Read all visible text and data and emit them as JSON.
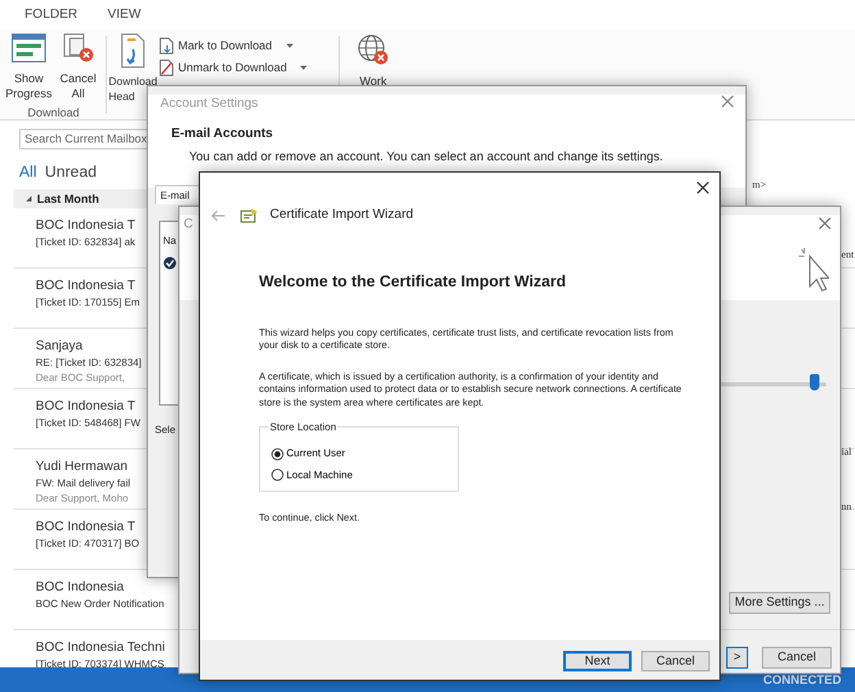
{
  "ribbon": {
    "tabs": [
      {
        "label": "FOLDER"
      },
      {
        "label": "VIEW"
      }
    ],
    "show_progress_button": {
      "label": "Show Progress"
    },
    "cancel_all_button": {
      "label": "Cancel All"
    },
    "group_label": "Download",
    "download_headers_button": {
      "label": "Download Head"
    },
    "small_buttons": [
      {
        "label": "Mark to Download"
      },
      {
        "label": "Unmark to Download"
      }
    ],
    "work_button": {
      "label": "Work"
    }
  },
  "mailbox": {
    "search": {
      "placeholder": "Search Current Mailbox"
    },
    "filters": [
      {
        "label": "All",
        "selected": true
      },
      {
        "label": "Unread",
        "selected": false
      }
    ],
    "group_header": "Last Month",
    "messages": [
      {
        "sender": "BOC Indonesia T",
        "lines": [
          "[Ticket ID: 632834] ak"
        ]
      },
      {
        "sender": "BOC Indonesia T",
        "lines": [
          "[Ticket ID: 170155] Em"
        ]
      },
      {
        "sender": "Sanjaya",
        "lines": [
          "RE: [Ticket ID: 632834]",
          "Dear BOC Support,"
        ]
      },
      {
        "sender": "BOC Indonesia T",
        "lines": [
          "[Ticket ID: 548468] FW"
        ]
      },
      {
        "sender": "Yudi Hermawan",
        "lines": [
          "FW: Mail delivery fail",
          "Dear Support,  Moho"
        ]
      },
      {
        "sender": "BOC Indonesia T",
        "lines": [
          "[Ticket ID: 470317] BO"
        ]
      },
      {
        "sender": "BOC Indonesia",
        "lines": [
          "BOC New Order Notification"
        ]
      },
      {
        "sender": "BOC Indonesia Techni",
        "lines": [
          "[Ticket ID: 703374] WHMCS"
        ]
      }
    ]
  },
  "reading_pane": [
    "m>",
    "ent",
    "ial",
    "nn"
  ],
  "status_bar": {
    "text": "CONNECTED"
  },
  "account_settings": {
    "title": "Account Settings",
    "heading": "E-mail Accounts",
    "description": "You can add or remove an account. You can select an account and change its settings.",
    "tab": "E-mail",
    "column_header": "Na",
    "footer_text": "Sele"
  },
  "change_account": {
    "title": "C",
    "slider": {
      "level": 0.98
    },
    "more_settings_button": "More Settings ...",
    "next_button": ">",
    "cancel_button": "Cancel"
  },
  "wizard": {
    "title": "Certificate Import Wizard",
    "heading": "Welcome to the Certificate Import Wizard",
    "paragraphs": [
      "This wizard helps you copy certificates, certificate trust lists, and certificate revocation lists from your disk to a certificate store.",
      "A certificate, which is issued by a certification authority, is a confirmation of your identity and contains information used to protect data or to establish secure network connections. A certificate store is the system area where certificates are kept."
    ],
    "store_location": {
      "legend": "Store Location",
      "options": [
        {
          "label": "Current User",
          "selected": true
        },
        {
          "label": "Local Machine",
          "selected": false
        }
      ]
    },
    "hint": "To continue, click Next.",
    "buttons": [
      {
        "label": "Next",
        "kind": "primary"
      },
      {
        "label": "Cancel",
        "kind": "normal"
      }
    ]
  }
}
